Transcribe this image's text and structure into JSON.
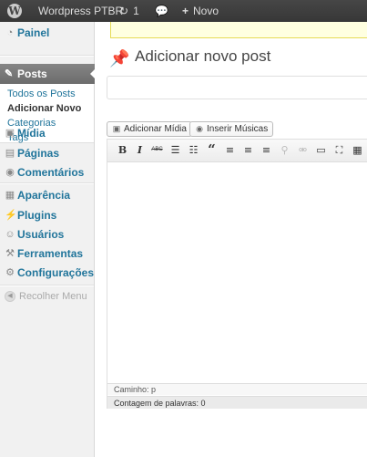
{
  "adminbar": {
    "logo_icon": "wordpress-logo-icon",
    "site_name": "Wordpress PTBR",
    "updates_icon": "refresh-icon",
    "updates_count": "1",
    "comments_icon": "speech-bubble-icon",
    "new_icon": "plus-icon",
    "new_label": "Novo"
  },
  "sidebar": {
    "painel": "Painel",
    "posts": "Posts",
    "submenu": [
      "Todos os Posts",
      "Adicionar Novo",
      "Categorias",
      "Tags"
    ],
    "midia": "Mídia",
    "paginas": "Páginas",
    "comentarios": "Comentários",
    "aparencia": "Aparência",
    "plugins": "Plugins",
    "usuarios": "Usuários",
    "ferramentas": "Ferramentas",
    "configuracoes": "Configurações",
    "collapse": "Recolher Menu"
  },
  "main": {
    "title": "Adicionar novo post",
    "title_icon": "pushpin-icon",
    "title_input_value": "",
    "add_media": "Adicionar Mídia",
    "insert_music": "Inserir Músicas",
    "status_path": "Caminho: p",
    "word_count": "Contagem de palavras: 0"
  },
  "toolbar": {
    "bold": "B",
    "italic": "I",
    "strikethrough": "ABC",
    "quote": "“"
  },
  "colors": {
    "adminbar": "#464646",
    "link": "#21759b",
    "notice_bg": "#ffffe0",
    "current_menu": "#777777"
  }
}
